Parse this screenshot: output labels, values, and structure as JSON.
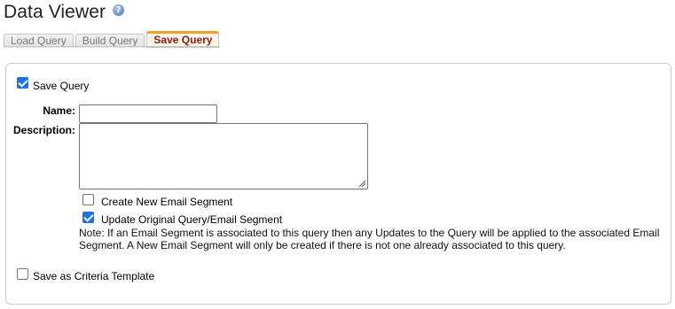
{
  "page": {
    "title": "Data Viewer"
  },
  "tabs": [
    {
      "label": "Load Query",
      "active": false
    },
    {
      "label": "Build Query",
      "active": false
    },
    {
      "label": "Save Query",
      "active": true
    }
  ],
  "form": {
    "save_query": {
      "label": "Save Query",
      "checked": true
    },
    "name": {
      "label": "Name:",
      "value": ""
    },
    "description": {
      "label": "Description:",
      "value": ""
    },
    "create_segment": {
      "label": "Create New Email Segment",
      "checked": false
    },
    "update_original": {
      "label": "Update Original Query/Email Segment",
      "checked": true
    },
    "note": "Note: If an Email Segment is associated to this query then any Updates to the Query will be applied to the associated Email Segment. A New Email Segment will only be created if there is not one already associated to this query.",
    "criteria_template": {
      "label": "Save as Criteria Template",
      "checked": false
    }
  },
  "colors": {
    "accent": "#1a73e8",
    "active_tab_text": "#8b1a1a",
    "active_tab_border": "#f0a030"
  },
  "icons": [
    "help-icon",
    "resize-grip-icon"
  ]
}
